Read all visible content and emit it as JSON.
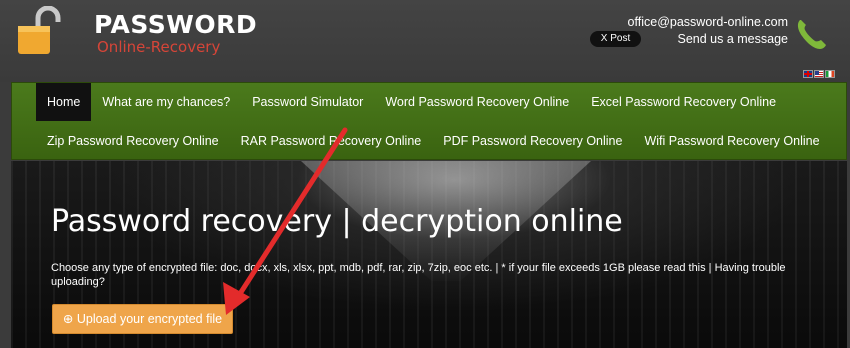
{
  "header": {
    "logo_title": "PASSWORD",
    "logo_subtitle": "Online-Recovery",
    "x_post_label": "X Post",
    "email": "office@password-online.com",
    "send_message": "Send us a message",
    "icons": [
      "padlock-icon",
      "phone-icon"
    ],
    "flags": [
      "flag-uk-icon",
      "flag-us-icon",
      "flag-it-icon"
    ]
  },
  "nav": {
    "row1": [
      {
        "label": "Home"
      },
      {
        "label": "What are my chances?"
      },
      {
        "label": "Password Simulator"
      },
      {
        "label": "Word Password Recovery Online"
      },
      {
        "label": "Excel Password Recovery Online"
      }
    ],
    "row2": [
      {
        "label": "Zip Password Recovery Online"
      },
      {
        "label": "RAR Password Recovery Online"
      },
      {
        "label": "PDF Password Recovery Online"
      },
      {
        "label": "Wifi Password Recovery Online"
      }
    ]
  },
  "hero": {
    "title": "Password recovery | decryption online",
    "description": "Choose any type of encrypted file: doc, docx, xls, xlsx, ppt, mdb, pdf, rar, zip, 7zip, eoc etc.  |  * if your file exceeds 1GB please read this  |  Having trouble uploading?",
    "upload_label": "⊕ Upload your encrypted file"
  },
  "colors": {
    "nav_green": "#4b7a1c",
    "upload_orange": "#efa54a",
    "subtitle_red": "#d64538",
    "arrow_red": "#e32b2b"
  }
}
